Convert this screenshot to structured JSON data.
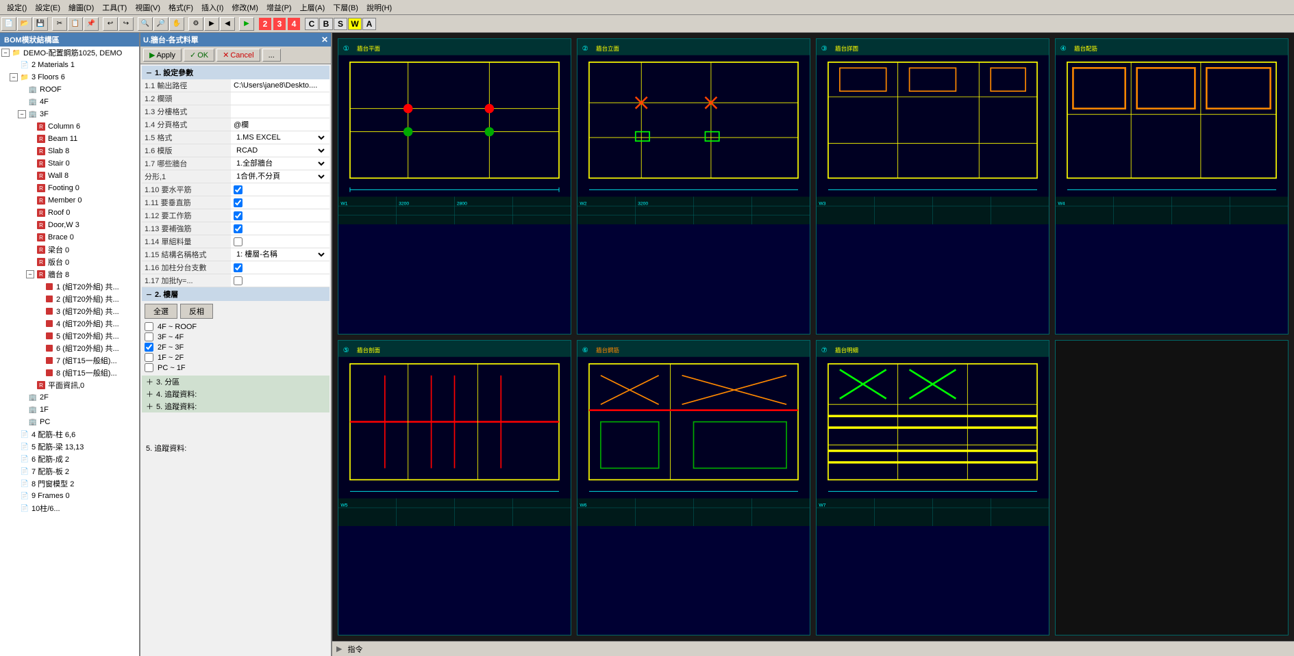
{
  "app": {
    "title": "CAD Application"
  },
  "menus": {
    "items": [
      "設定()",
      "設定(E)",
      "繪圖(D)",
      "工具(T)",
      "視圖(V)",
      "格式(F)",
      "插入(I)",
      "修改(M)",
      "增益(P)",
      "上層(A)",
      "下層(B)",
      "說明(H)"
    ]
  },
  "left_panel": {
    "title": "BOM模狀結構區",
    "tree": [
      {
        "id": "demo",
        "label": "DEMO-配置鋼筋1025, DEMO",
        "level": 0,
        "expandable": true,
        "expanded": true,
        "icon": "folder"
      },
      {
        "id": "mat",
        "label": "2 Materials 1",
        "level": 1,
        "expandable": false,
        "icon": "doc"
      },
      {
        "id": "floors",
        "label": "3 Floors 6",
        "level": 1,
        "expandable": true,
        "expanded": true,
        "icon": "folder"
      },
      {
        "id": "roof",
        "label": "ROOF",
        "level": 2,
        "expandable": false,
        "icon": "building"
      },
      {
        "id": "4f",
        "label": "4F",
        "level": 2,
        "expandable": false,
        "icon": "building"
      },
      {
        "id": "3f",
        "label": "3F",
        "level": 2,
        "expandable": true,
        "expanded": true,
        "icon": "building"
      },
      {
        "id": "col",
        "label": "Column 6",
        "level": 3,
        "expandable": false,
        "icon": "red-icon"
      },
      {
        "id": "beam",
        "label": "Beam 11",
        "level": 3,
        "expandable": false,
        "icon": "red-icon"
      },
      {
        "id": "slab",
        "label": "Slab 8",
        "level": 3,
        "expandable": false,
        "icon": "red-icon"
      },
      {
        "id": "stair",
        "label": "Stair 0",
        "level": 3,
        "expandable": false,
        "icon": "red-icon"
      },
      {
        "id": "wall",
        "label": "Wall 8",
        "level": 3,
        "expandable": false,
        "icon": "red-icon"
      },
      {
        "id": "footing",
        "label": "Footing 0",
        "level": 3,
        "expandable": false,
        "icon": "red-icon"
      },
      {
        "id": "member",
        "label": "Member 0",
        "level": 3,
        "expandable": false,
        "icon": "red-icon"
      },
      {
        "id": "roof0",
        "label": "Roof 0",
        "level": 3,
        "expandable": false,
        "icon": "red-icon"
      },
      {
        "id": "doorw",
        "label": "Door,W 3",
        "level": 3,
        "expandable": false,
        "icon": "red-icon"
      },
      {
        "id": "brace",
        "label": "Brace 0",
        "level": 3,
        "expandable": false,
        "icon": "red-icon"
      },
      {
        "id": "liang",
        "label": "梁台 0",
        "level": 3,
        "expandable": false,
        "icon": "red-icon"
      },
      {
        "id": "bantai",
        "label": "版台 0",
        "level": 3,
        "expandable": false,
        "icon": "red-icon"
      },
      {
        "id": "pentai",
        "label": "牆台 8",
        "level": 3,
        "expandable": true,
        "expanded": true,
        "icon": "red-icon"
      },
      {
        "id": "p1",
        "label": "1 (組T20外組) 共...",
        "level": 4,
        "expandable": false,
        "icon": "small-red"
      },
      {
        "id": "p2",
        "label": "2 (組T20外組) 共...",
        "level": 4,
        "expandable": false,
        "icon": "small-red"
      },
      {
        "id": "p3",
        "label": "3 (組T20外組) 共...",
        "level": 4,
        "expandable": false,
        "icon": "small-red"
      },
      {
        "id": "p4",
        "label": "4 (組T20外組) 共...",
        "level": 4,
        "expandable": false,
        "icon": "small-red"
      },
      {
        "id": "p5",
        "label": "5 (組T20外組) 共...",
        "level": 4,
        "expandable": false,
        "icon": "small-red"
      },
      {
        "id": "p6",
        "label": "6 (組T20外組) 共...",
        "level": 4,
        "expandable": false,
        "icon": "small-red"
      },
      {
        "id": "p7",
        "label": "7 (組T15一般組)...",
        "level": 4,
        "expandable": false,
        "icon": "small-red"
      },
      {
        "id": "p8",
        "label": "8 (組T15一般組)...",
        "level": 4,
        "expandable": false,
        "icon": "small-red"
      },
      {
        "id": "pingmian",
        "label": "平面資訊,0",
        "level": 3,
        "expandable": false,
        "icon": "red-icon"
      },
      {
        "id": "2f",
        "label": "2F",
        "level": 2,
        "expandable": false,
        "icon": "building"
      },
      {
        "id": "1f",
        "label": "1F",
        "level": 2,
        "expandable": false,
        "icon": "building"
      },
      {
        "id": "pc",
        "label": "PC",
        "level": 2,
        "expandable": false,
        "icon": "building"
      },
      {
        "id": "cfg4",
        "label": "4 配筋-柱 6,6",
        "level": 1,
        "expandable": false,
        "icon": "doc"
      },
      {
        "id": "cfg5",
        "label": "5 配筋-梁 13,13",
        "level": 1,
        "expandable": false,
        "icon": "doc"
      },
      {
        "id": "cfg6",
        "label": "6 配筋-成 2",
        "level": 1,
        "expandable": false,
        "icon": "doc"
      },
      {
        "id": "cfg7",
        "label": "7 配筋-板 2",
        "level": 1,
        "expandable": false,
        "icon": "doc"
      },
      {
        "id": "cfg8",
        "label": "8 門窗模型 2",
        "level": 1,
        "expandable": false,
        "icon": "doc"
      },
      {
        "id": "cfg9",
        "label": "9 Frames 0",
        "level": 1,
        "expandable": false,
        "icon": "doc"
      },
      {
        "id": "cfg10",
        "label": "10柱/6...",
        "level": 1,
        "expandable": false,
        "icon": "doc"
      }
    ]
  },
  "mid_panel": {
    "title": "U.牆台-各式料單",
    "buttons": {
      "apply": "Apply",
      "ok": "OK",
      "cancel": "Cancel"
    },
    "sections": {
      "settings": {
        "title": "1. 設定參數",
        "fields": [
          {
            "key": "1.1 輸出路徑",
            "value": "C:\\Users\\jane8\\Deskto...."
          },
          {
            "key": "1.2 欄頭",
            "value": ""
          },
          {
            "key": "1.3 分樓格式",
            "value": ""
          },
          {
            "key": "1.4 分頁格式",
            "value": "@欄"
          },
          {
            "key": "1.5 格式",
            "value": "1.MS EXCEL",
            "type": "select"
          },
          {
            "key": "1.6 模版",
            "value": "RCAD",
            "type": "select"
          },
          {
            "key": "1.7 哪些牆台",
            "value": "1.全部牆台",
            "type": "select"
          },
          {
            "key": "分形,1",
            "value": "1合併,不分頁",
            "type": "select"
          },
          {
            "key": "1.10 要水平筋",
            "value": true,
            "type": "checkbox"
          },
          {
            "key": "1.11 要垂直筋",
            "value": true,
            "type": "checkbox"
          },
          {
            "key": "1.12 要工作筋",
            "value": true,
            "type": "checkbox"
          },
          {
            "key": "1.13 要補強筋",
            "value": true,
            "type": "checkbox"
          },
          {
            "key": "1.14 單組料量",
            "value": false,
            "type": "checkbox"
          },
          {
            "key": "1.15 結構名稱格式",
            "value": "1: 樓層-名稱",
            "type": "select"
          },
          {
            "key": "1.16 加柱分台支數",
            "value": true,
            "type": "checkbox"
          },
          {
            "key": "1.17 加批fy=...",
            "value": false,
            "type": "checkbox"
          }
        ]
      },
      "floors": {
        "title": "2. 樓層",
        "select_all": "全選",
        "deselect_all": "反相",
        "items": [
          {
            "label": "4F ~ ROOF",
            "checked": false
          },
          {
            "label": "3F ~ 4F",
            "checked": false
          },
          {
            "label": "2F ~ 3F",
            "checked": true
          },
          {
            "label": "1F ~ 2F",
            "checked": false
          },
          {
            "label": "PC ~ 1F",
            "checked": false
          }
        ]
      },
      "zone": {
        "title": "3. 分區"
      },
      "param4": {
        "title": "4. 追蹤資料:"
      },
      "param5": {
        "title": "5. 追蹤資料:"
      }
    }
  },
  "right_panel": {
    "tabs": [
      "C",
      "B",
      "S",
      "W",
      "A"
    ],
    "active_tab": "W",
    "drawings": [
      {
        "id": 1,
        "type": "plan-red",
        "has_top_bar": true
      },
      {
        "id": 2,
        "type": "plan-red-2",
        "has_top_bar": true
      },
      {
        "id": 3,
        "type": "plan-yellow",
        "has_top_bar": true
      },
      {
        "id": 4,
        "type": "plan-outline",
        "has_top_bar": true
      },
      {
        "id": 5,
        "type": "elevation-red",
        "has_top_bar": false
      },
      {
        "id": 6,
        "type": "elevation-red-2",
        "has_top_bar": false
      },
      {
        "id": 7,
        "type": "elevation-yellow",
        "has_top_bar": false
      }
    ]
  },
  "bottom": {
    "command_label": "指令"
  }
}
